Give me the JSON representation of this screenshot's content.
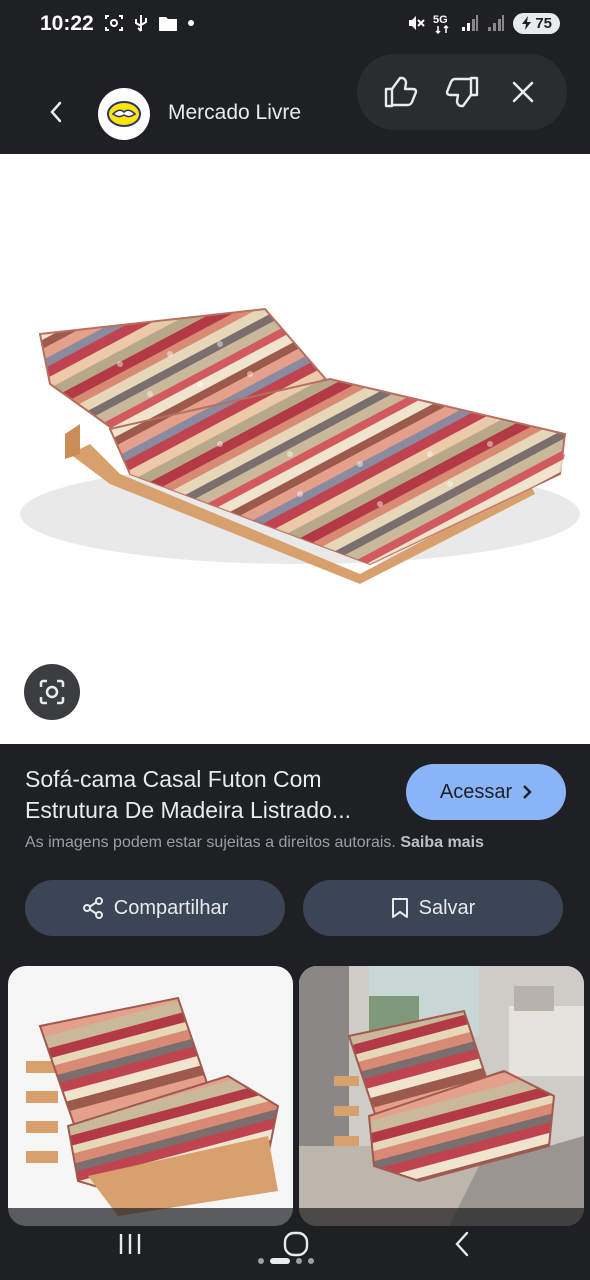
{
  "status_bar": {
    "time": "10:22",
    "battery": "75",
    "network": "5G"
  },
  "header": {
    "back_icon": "chevron-left-icon",
    "site_name": "Mercado Livre",
    "feedback": {
      "like_icon": "thumbs-up-icon",
      "dislike_icon": "thumbs-down-icon",
      "close_icon": "close-icon"
    }
  },
  "image": {
    "lens_icon": "google-lens-icon"
  },
  "result": {
    "title": "Sofá-cama Casal Futon Com Estrutura De Madeira Listrado...",
    "visit_label": "Acessar",
    "copyright_text": "As imagens podem estar sujeitas a direitos autorais.",
    "learn_more": "Saiba mais",
    "share_label": "Compartilhar",
    "save_label": "Salvar"
  },
  "colors": {
    "background": "#1f2023",
    "accent": "#8ab4f8",
    "action_button": "#3b4556"
  }
}
